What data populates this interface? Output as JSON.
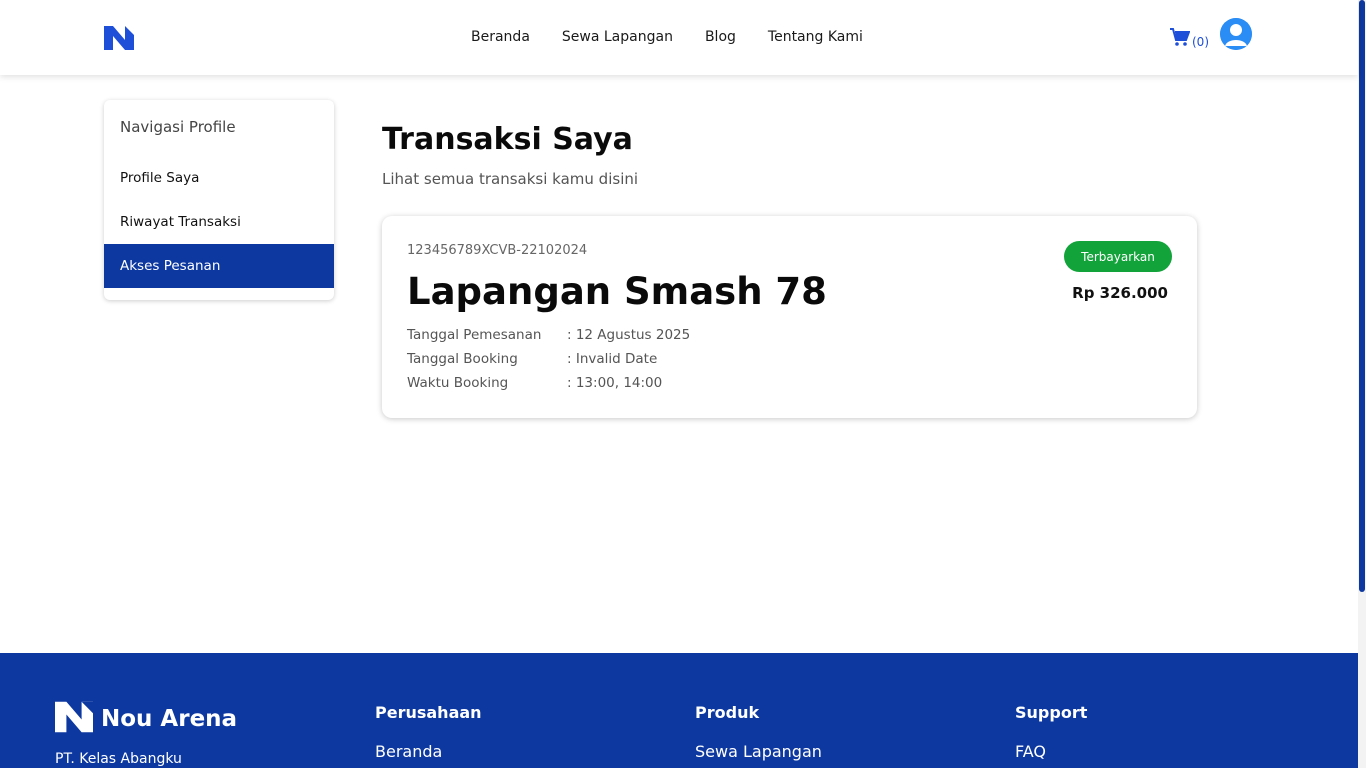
{
  "header": {
    "nav": [
      "Beranda",
      "Sewa Lapangan",
      "Blog",
      "Tentang Kami"
    ],
    "cart_count": "(0)",
    "logo_icon": "n-logo-icon",
    "cart_icon": "cart-icon",
    "avatar_icon": "user-avatar-icon"
  },
  "sidebar": {
    "title": "Navigasi Profile",
    "items": [
      {
        "label": "Profile Saya",
        "active": false
      },
      {
        "label": "Riwayat Transaksi",
        "active": false
      },
      {
        "label": "Akses Pesanan",
        "active": true
      }
    ]
  },
  "main": {
    "title": "Transaksi Saya",
    "subtitle": "Lihat semua transaksi kamu disini",
    "transaction": {
      "order_id": "123456789XCVB-22102024",
      "venue": "Lapangan Smash 78",
      "status": "Terbayarkan",
      "price": "Rp 326.000",
      "rows": [
        {
          "label": "Tanggal Pemesanan",
          "value": ": 12 Agustus 2025"
        },
        {
          "label": "Tanggal Booking",
          "value": ": Invalid Date"
        },
        {
          "label": "Waktu Booking",
          "value": ": 13:00, 14:00"
        }
      ]
    }
  },
  "footer": {
    "brand": "Nou Arena",
    "company": "PT. Kelas Abangku",
    "columns": [
      {
        "heading": "Perusahaan",
        "first_link": "Beranda"
      },
      {
        "heading": "Produk",
        "first_link": "Sewa Lapangan"
      },
      {
        "heading": "Support",
        "first_link": "FAQ"
      }
    ]
  },
  "colors": {
    "primary": "#0d38a0",
    "status_paid": "#13a33b",
    "accent": "#1e4fd8"
  }
}
